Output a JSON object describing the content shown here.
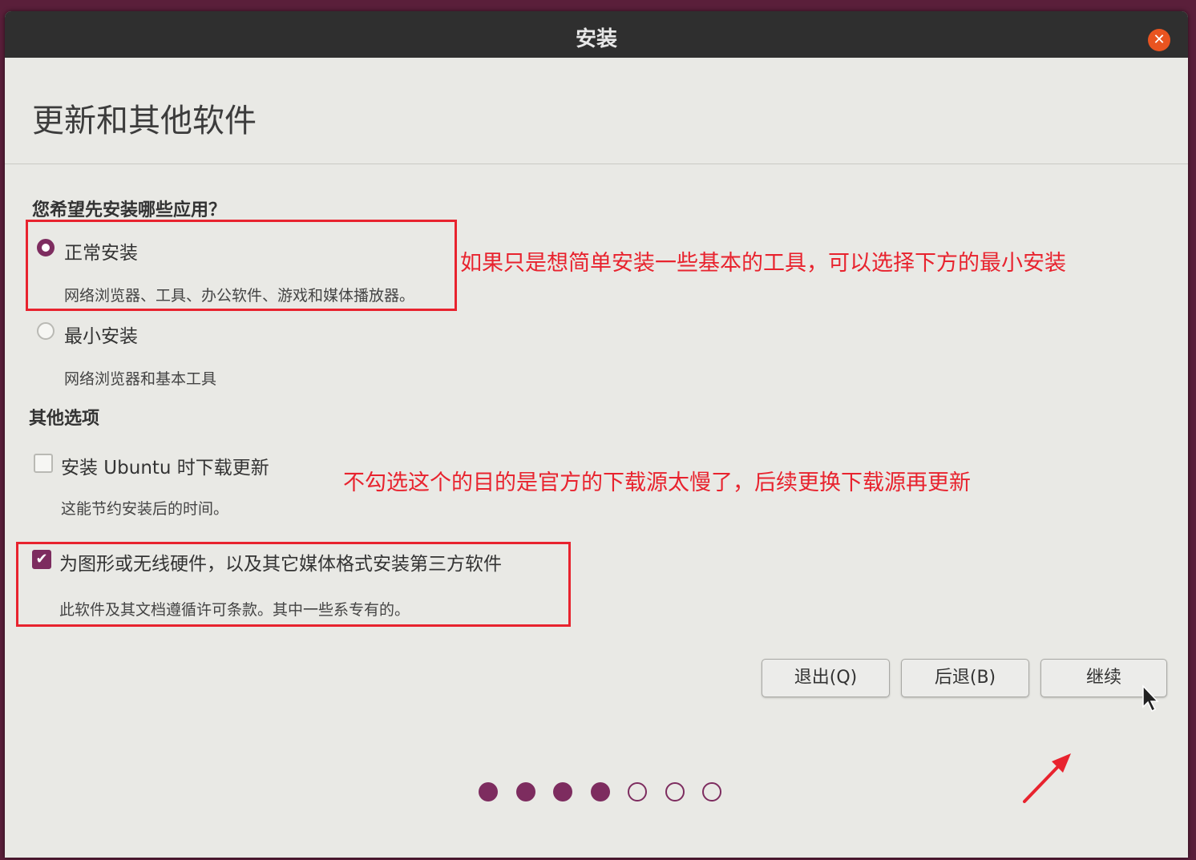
{
  "window": {
    "title": "安装"
  },
  "page": {
    "title": "更新和其他软件"
  },
  "apps_section": {
    "label": "您希望先安装哪些应用？",
    "options": [
      {
        "label": "正常安装",
        "desc": "网络浏览器、工具、办公软件、游戏和媒体播放器。",
        "selected": true
      },
      {
        "label": "最小安装",
        "desc": "网络浏览器和基本工具",
        "selected": false
      }
    ]
  },
  "other_section": {
    "label": "其他选项",
    "options": [
      {
        "label": "安装 Ubuntu 时下载更新",
        "desc": "这能节约安装后的时间。",
        "checked": false
      },
      {
        "label": "为图形或无线硬件，以及其它媒体格式安装第三方软件",
        "desc": "此软件及其文档遵循许可条款。其中一些系专有的。",
        "checked": true
      }
    ]
  },
  "annotations": {
    "minimal": "如果只是想简单安装一些基本的工具，可以选择下方的最小安装",
    "updates": "不勾选这个的目的是官方的下载源太慢了，后续更换下载源再更新"
  },
  "buttons": {
    "quit": "退出(Q)",
    "back": "后退(B)",
    "continue": "继续"
  },
  "progress": {
    "total_steps": 7,
    "completed_steps": 4
  },
  "colors": {
    "accent": "#7d2c5f",
    "annotation": "#e8232e",
    "close": "#e95420"
  }
}
